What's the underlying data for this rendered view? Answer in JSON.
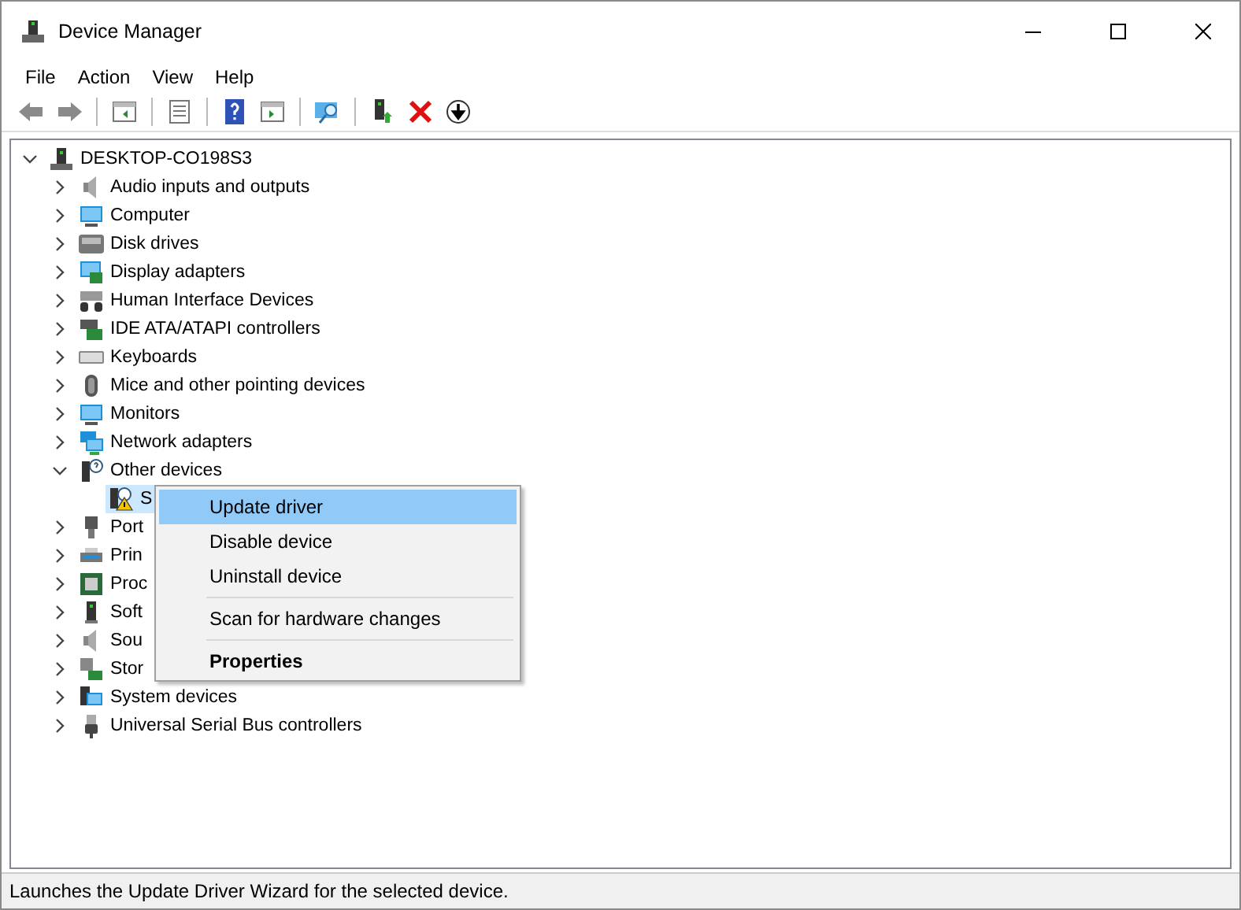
{
  "window": {
    "title": "Device Manager"
  },
  "menu_bar": [
    {
      "label": "File"
    },
    {
      "label": "Action"
    },
    {
      "label": "View"
    },
    {
      "label": "Help"
    }
  ],
  "tree": [
    {
      "label": "DESKTOP-CO198S3",
      "expanded": true,
      "selected": false,
      "children": [
        {
          "label": "Audio inputs and outputs",
          "expanded": false,
          "selected": false
        },
        {
          "label": "Computer",
          "expanded": false,
          "selected": false
        },
        {
          "label": "Disk drives",
          "expanded": false,
          "selected": false
        },
        {
          "label": "Display adapters",
          "expanded": false,
          "selected": false
        },
        {
          "label": "Human Interface Devices",
          "expanded": false,
          "selected": false
        },
        {
          "label": "IDE ATA/ATAPI controllers",
          "expanded": false,
          "selected": false
        },
        {
          "label": "Keyboards",
          "expanded": false,
          "selected": false
        },
        {
          "label": "Mice and other pointing devices",
          "expanded": false,
          "selected": false
        },
        {
          "label": "Monitors",
          "expanded": false,
          "selected": false
        },
        {
          "label": "Network adapters",
          "expanded": false,
          "selected": false
        },
        {
          "label": "Other devices",
          "expanded": true,
          "selected": false,
          "children": [
            {
              "label": "S",
              "selected": true
            }
          ]
        },
        {
          "label": "Port",
          "expanded": false,
          "selected": false
        },
        {
          "label": "Prin",
          "expanded": false,
          "selected": false
        },
        {
          "label": "Proc",
          "expanded": false,
          "selected": false
        },
        {
          "label": "Soft",
          "expanded": false,
          "selected": false
        },
        {
          "label": "Sou",
          "expanded": false,
          "selected": false
        },
        {
          "label": "Stor",
          "expanded": false,
          "selected": false
        },
        {
          "label": "System devices",
          "expanded": false,
          "selected": false
        },
        {
          "label": "Universal Serial Bus controllers",
          "expanded": false,
          "selected": false
        }
      ]
    }
  ],
  "context_menu": [
    {
      "kind": "item",
      "label": "Update driver",
      "selected": true,
      "default": false
    },
    {
      "kind": "item",
      "label": "Disable device",
      "selected": false,
      "default": false
    },
    {
      "kind": "item",
      "label": "Uninstall device",
      "selected": false,
      "default": false
    },
    {
      "kind": "separator"
    },
    {
      "kind": "item",
      "label": "Scan for hardware changes",
      "selected": false,
      "default": false
    },
    {
      "kind": "separator"
    },
    {
      "kind": "item",
      "label": "Properties",
      "selected": false,
      "default": true
    }
  ],
  "status_bar": "Launches the Update Driver Wizard for the selected device."
}
